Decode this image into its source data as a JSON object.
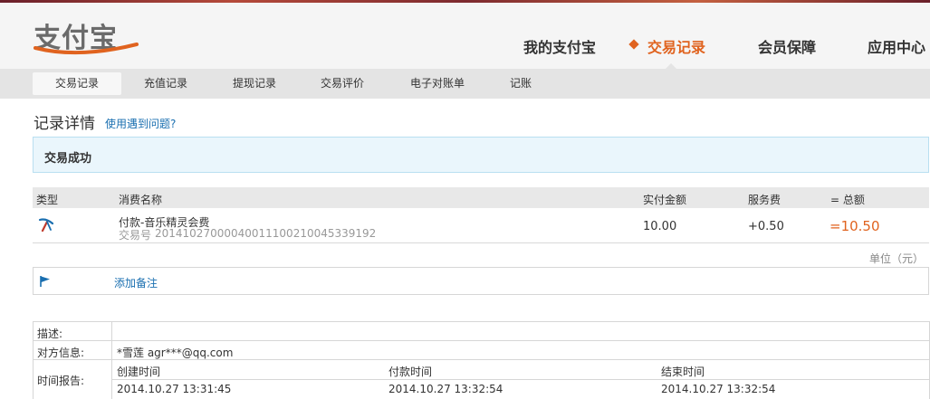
{
  "brand": {
    "logo_text": "支付宝"
  },
  "main_nav": [
    {
      "label": "我的支付宝",
      "active": false
    },
    {
      "label": "交易记录",
      "active": true
    },
    {
      "label": "会员保障",
      "active": false
    },
    {
      "label": "应用中心",
      "active": false
    }
  ],
  "sub_nav": [
    {
      "label": "交易记录",
      "active": true
    },
    {
      "label": "充值记录",
      "active": false
    },
    {
      "label": "提现记录",
      "active": false
    },
    {
      "label": "交易评价",
      "active": false
    },
    {
      "label": "电子对账单",
      "active": false
    },
    {
      "label": "记账",
      "active": false
    }
  ],
  "page": {
    "title": "记录详情",
    "help_link": "使用遇到问题?"
  },
  "status": {
    "text": "交易成功"
  },
  "table": {
    "headers": {
      "type": "类型",
      "name": "消费名称",
      "paid": "实付金额",
      "fee": "服务费",
      "total": "= 总额"
    },
    "row": {
      "name": "付款-音乐精灵会费",
      "trade_label": "交易号",
      "trade_no": "2014102700004001110021004533919⁠​2",
      "paid": "10.00",
      "fee": "+0.50",
      "total": "=10.50"
    }
  },
  "unit_note": "单位（元）",
  "remark": {
    "label": "添加备注"
  },
  "info": {
    "desc_label": "描述:",
    "desc_value": "",
    "counterparty_label": "对方信息:",
    "counterparty_value": "*雪莲 agr***@qq.com",
    "time_label": "时间报告:",
    "created_label": "创建时间",
    "created_value": "2014.10.27 13:31:45",
    "paid_label": "付款时间",
    "paid_value": "2014.10.27 13:32:54",
    "end_label": "结束时间",
    "end_value": "2014.10.27 13:32:54"
  },
  "colors": {
    "accent": "#e0631f",
    "link": "#1a6fb0",
    "status_bg": "#eaf6fc"
  }
}
